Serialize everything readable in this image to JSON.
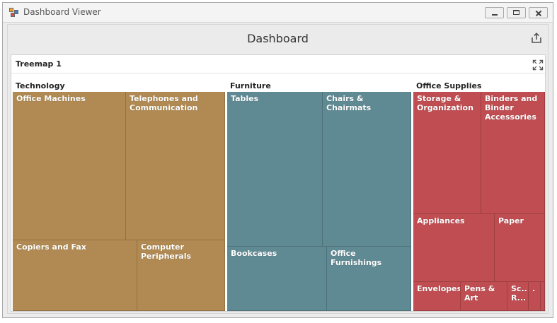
{
  "window": {
    "title": "Dashboard Viewer",
    "icon": "dashboard-app-icon"
  },
  "dashboard": {
    "title": "Dashboard",
    "export_icon": "export-icon"
  },
  "panel": {
    "title": "Treemap 1",
    "fullscreen_icon": "maximize-icon"
  },
  "colors": {
    "technology": "#b08a52",
    "furniture": "#608a93",
    "office_supplies": "#bf4d51"
  },
  "groups": [
    {
      "label": "Technology",
      "tiles": [
        "Office Machines",
        "Telephones and Communication",
        "Copiers and Fax",
        "Computer Peripherals"
      ]
    },
    {
      "label": "Furniture",
      "tiles": [
        "Tables",
        "Chairs & Chairmats",
        "Bookcases",
        "Office Furnishings"
      ]
    },
    {
      "label": "Office Supplies",
      "tiles": [
        "Storage & Organization",
        "Binders and Binder Accessories",
        "Appliances",
        "Paper",
        "Envelopes",
        "Pens & Art",
        "Sc.. R...",
        "."
      ]
    }
  ]
}
